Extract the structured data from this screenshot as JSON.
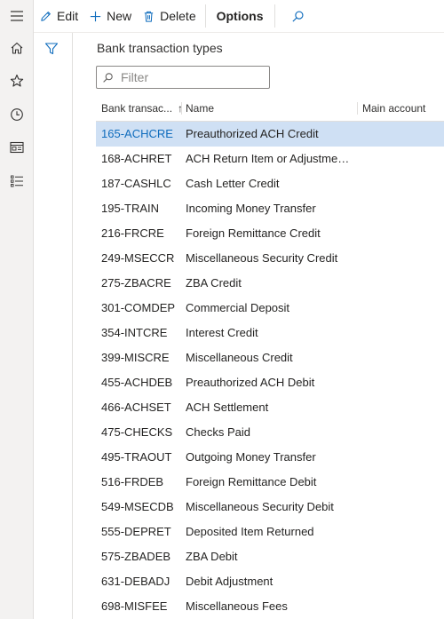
{
  "nav": {
    "items": [
      {
        "name": "menu-icon"
      },
      {
        "name": "home-icon"
      },
      {
        "name": "star-icon"
      },
      {
        "name": "clock-icon"
      },
      {
        "name": "workspace-icon"
      },
      {
        "name": "list-icon"
      }
    ]
  },
  "toolbar": {
    "edit_label": "Edit",
    "new_label": "New",
    "delete_label": "Delete",
    "options_label": "Options"
  },
  "page": {
    "title": "Bank transaction types"
  },
  "filter": {
    "placeholder": "Filter"
  },
  "grid": {
    "columns": [
      "Bank transac...",
      "Name",
      "Main account"
    ],
    "sort_indicator": "↑",
    "selected_index": 0,
    "rows": [
      {
        "code": "165-ACHCRE",
        "name": "Preauthorized ACH Credit",
        "account": ""
      },
      {
        "code": "168-ACHRET",
        "name": "ACH Return Item or Adjustment ...",
        "account": ""
      },
      {
        "code": "187-CASHLC",
        "name": "Cash Letter Credit",
        "account": ""
      },
      {
        "code": "195-TRAIN",
        "name": "Incoming Money Transfer",
        "account": ""
      },
      {
        "code": "216-FRCRE",
        "name": "Foreign Remittance Credit",
        "account": ""
      },
      {
        "code": "249-MSECCR",
        "name": "Miscellaneous Security Credit",
        "account": ""
      },
      {
        "code": "275-ZBACRE",
        "name": "ZBA Credit",
        "account": ""
      },
      {
        "code": "301-COMDEP",
        "name": "Commercial Deposit",
        "account": ""
      },
      {
        "code": "354-INTCRE",
        "name": "Interest Credit",
        "account": ""
      },
      {
        "code": "399-MISCRE",
        "name": "Miscellaneous Credit",
        "account": ""
      },
      {
        "code": "455-ACHDEB",
        "name": "Preauthorized ACH Debit",
        "account": ""
      },
      {
        "code": "466-ACHSET",
        "name": "ACH Settlement",
        "account": ""
      },
      {
        "code": "475-CHECKS",
        "name": "Checks Paid",
        "account": ""
      },
      {
        "code": "495-TRAOUT",
        "name": "Outgoing Money Transfer",
        "account": ""
      },
      {
        "code": "516-FRDEB",
        "name": "Foreign Remittance Debit",
        "account": ""
      },
      {
        "code": "549-MSECDB",
        "name": "Miscellaneous Security Debit",
        "account": ""
      },
      {
        "code": "555-DEPRET",
        "name": "Deposited Item Returned",
        "account": ""
      },
      {
        "code": "575-ZBADEB",
        "name": "ZBA Debit",
        "account": ""
      },
      {
        "code": "631-DEBADJ",
        "name": "Debit Adjustment",
        "account": ""
      },
      {
        "code": "698-MISFEE",
        "name": "Miscellaneous Fees",
        "account": ""
      }
    ]
  },
  "colors": {
    "accent": "#0f6cbd",
    "selected_row": "#cfe0f4"
  }
}
